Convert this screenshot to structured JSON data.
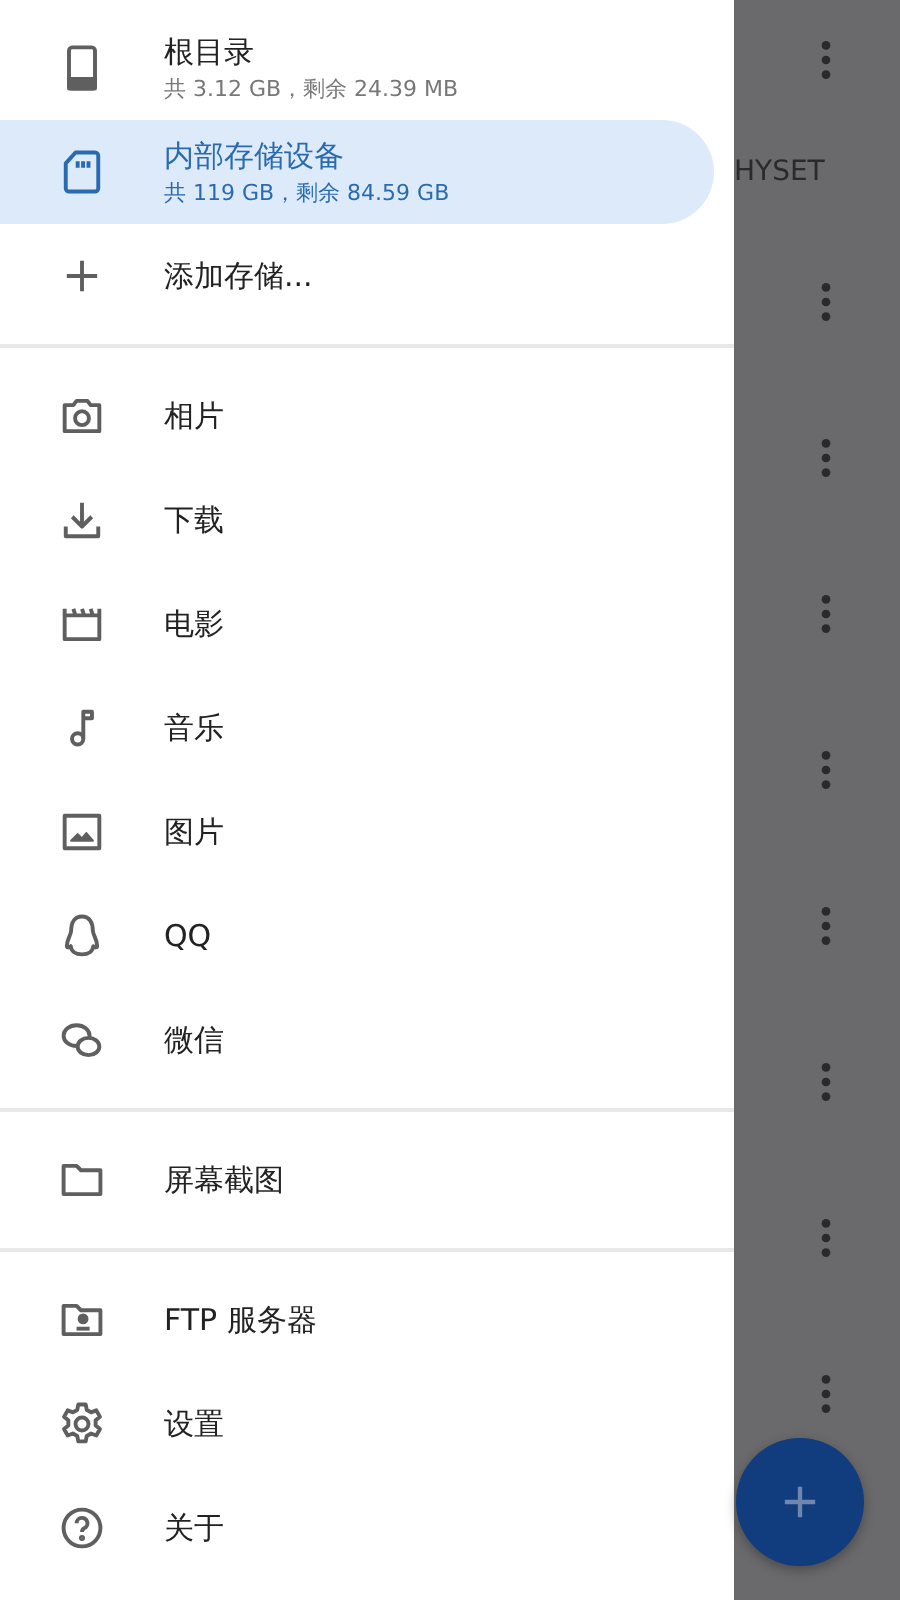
{
  "drawer": {
    "sections": [
      {
        "items": [
          {
            "title": "根目录",
            "subtitle": "共 3.12 GB，剩余 24.39 MB",
            "selected": false
          },
          {
            "title": "内部存储设备",
            "subtitle": "共 119 GB，剩余 84.59 GB",
            "selected": true
          },
          {
            "title": "添加存储...",
            "selected": false
          }
        ]
      },
      {
        "items": [
          {
            "title": "相片",
            "selected": false
          },
          {
            "title": "下载",
            "selected": false
          },
          {
            "title": "电影",
            "selected": false
          },
          {
            "title": "音乐",
            "selected": false
          },
          {
            "title": "图片",
            "selected": false
          },
          {
            "title": "QQ",
            "selected": false
          },
          {
            "title": "微信",
            "selected": false
          }
        ]
      },
      {
        "items": [
          {
            "title": "屏幕截图",
            "selected": false
          }
        ]
      },
      {
        "items": [
          {
            "title": "FTP 服务器",
            "selected": false
          },
          {
            "title": "设置",
            "selected": false
          },
          {
            "title": "关于",
            "selected": false
          }
        ]
      }
    ]
  },
  "background": {
    "tab_label": "HYSET"
  }
}
